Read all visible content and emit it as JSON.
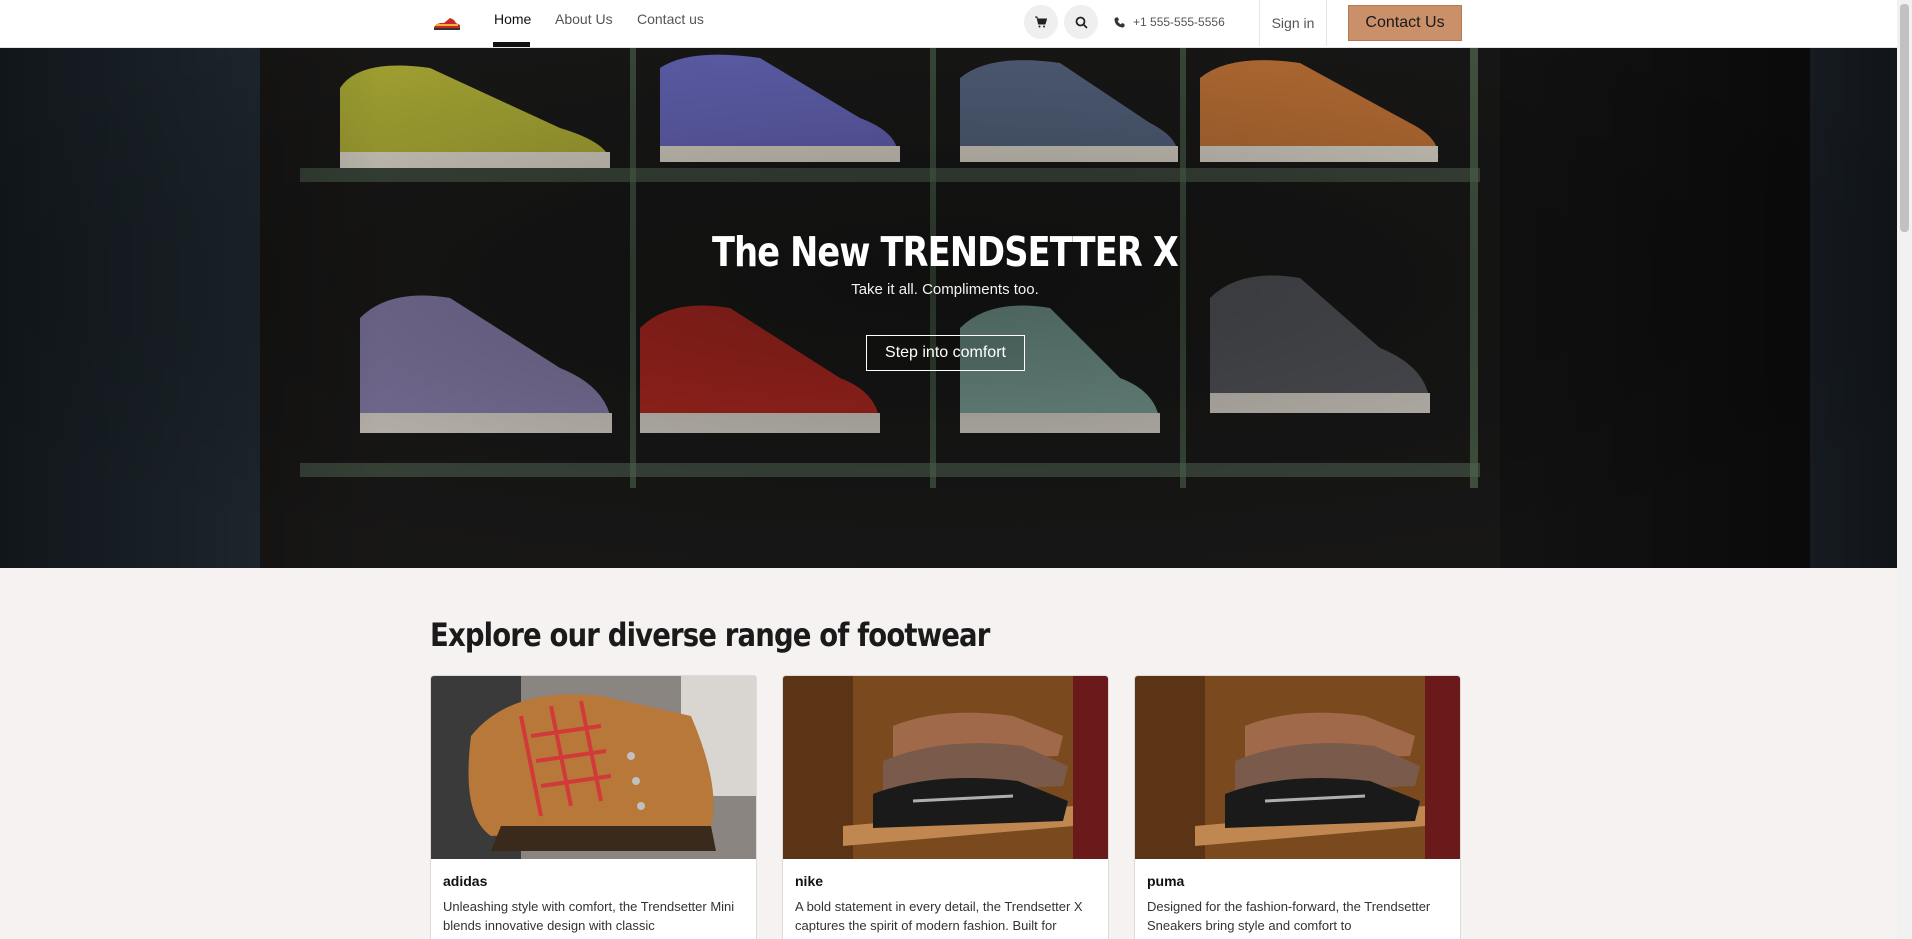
{
  "header": {
    "nav": [
      {
        "label": "Home",
        "active": true
      },
      {
        "label": "About Us",
        "active": false
      },
      {
        "label": "Contact us",
        "active": false
      }
    ],
    "icons": {
      "logo": "sneaker-logo",
      "cart": "cart-icon",
      "search": "search-icon",
      "phone": "phone-icon"
    },
    "phone": "+1 555-555-5556",
    "sign_in": "Sign in",
    "contact_button": "Contact Us"
  },
  "hero": {
    "title": "The New TRENDSETTER X",
    "subtitle": "Take it all. Compliments too.",
    "cta": "Step into comfort"
  },
  "section": {
    "title": "Explore our diverse range of footwear",
    "cards": [
      {
        "name": "adidas",
        "description": "Unleashing style with comfort, the Trendsetter Mini blends innovative design with classic"
      },
      {
        "name": "nike",
        "description": "A bold statement in every detail, the Trendsetter X captures the spirit of modern fashion. Built for"
      },
      {
        "name": "puma",
        "description": "Designed for the fashion-forward, the Trendsetter Sneakers bring style and comfort to"
      }
    ]
  },
  "colors": {
    "accent": "#c9906a",
    "background": "#f5f2f1",
    "header": "#ffffff",
    "text": "#1a1a1a"
  }
}
